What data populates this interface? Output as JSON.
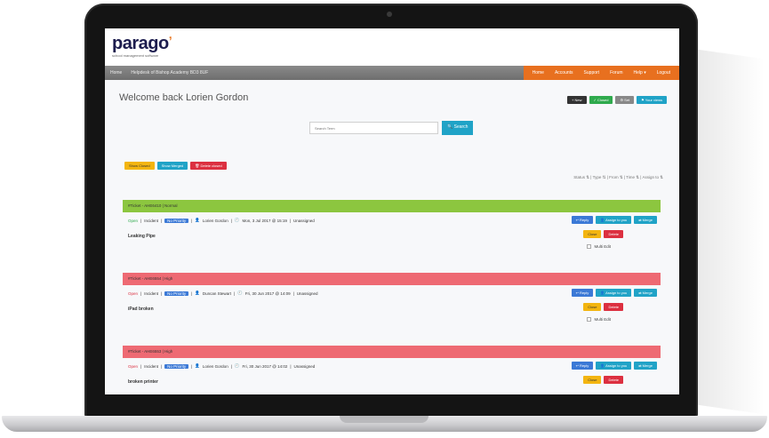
{
  "brand": {
    "logo": "parago",
    "tagline": "school management software"
  },
  "nav": {
    "home": "Home",
    "school": "Helpdesk of Bishop Academy BD3 8UF",
    "right": [
      "Home",
      "Accounts",
      "Support",
      "Forum",
      "Help ▾",
      "Logout"
    ]
  },
  "welcome": "Welcome back Lorien Gordon",
  "top_actions": [
    "+ New",
    "✓ Closed",
    "⚙ Set",
    "⚑ Your views"
  ],
  "search": {
    "placeholder": "Search Term",
    "button": "🔍 Search"
  },
  "filters": [
    "Show Closed",
    "Show Merged",
    "🗑 Delete closed"
  ],
  "sort_row": "Status ⇅ | Type ⇅ | From ⇅ | Time ⇅ | Assign to ⇅",
  "tickets": [
    {
      "header": "#Ticket - AHE6410 | Normal",
      "status": "Open",
      "type": "Incident",
      "pill": "No Priority",
      "person": "Lorien Gordon",
      "time": "Mon, 3 Jul 2017 @ 15:19",
      "assign": "Unassigned",
      "title": "Leaking Pipe",
      "buttons": [
        "↩ Reply",
        "👤 Assign to you",
        "⇄ Merge"
      ],
      "buttons2": [
        "Close",
        "Delete"
      ],
      "multi": "Multi Edit"
    },
    {
      "header": "#Ticket - AHE6554 | High",
      "status": "Open",
      "type": "Incident",
      "pill": "No Priority",
      "person": "Duncan Stewart",
      "time": "Fri, 30 Jun 2017 @ 14:09",
      "assign": "Unassigned",
      "title": "iPad broken",
      "buttons": [
        "↩ Reply",
        "👤 Assign to you",
        "⇄ Merge"
      ],
      "buttons2": [
        "Close",
        "Delete"
      ],
      "multi": "Multi Edit"
    },
    {
      "header": "#Ticket - AHE6553 | High",
      "status": "Open",
      "type": "Incident",
      "pill": "No Priority",
      "person": "Lorien Gordon",
      "time": "Fri, 30 Jun 2017 @ 14:02",
      "assign": "Unassigned",
      "title": "broken printer",
      "buttons": [
        "↩ Reply",
        "👤 Assign to you",
        "⇄ Merge"
      ],
      "buttons2": [
        "Close",
        "Delete"
      ]
    }
  ]
}
